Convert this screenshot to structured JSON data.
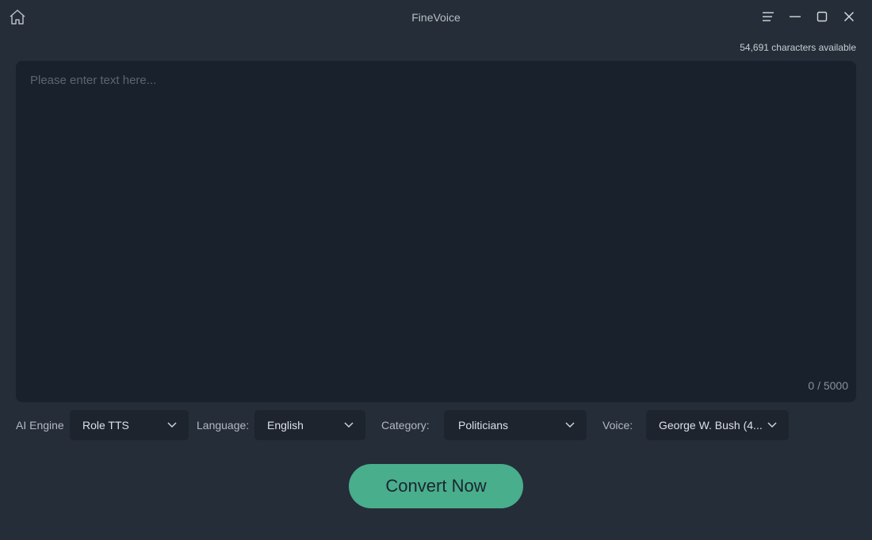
{
  "window": {
    "title": "FineVoice",
    "icons": {
      "home": "home-icon",
      "menu": "hamburger-menu-icon",
      "minimize": "minimize-icon",
      "maximize": "maximize-icon",
      "close": "close-icon"
    }
  },
  "header": {
    "characters_available": "54,691 characters available"
  },
  "editor": {
    "placeholder": "Please enter text here...",
    "value": "",
    "counter": "0 / 5000"
  },
  "options": {
    "ai_engine": {
      "label": "AI Engine",
      "value": "Role TTS"
    },
    "language": {
      "label": "Language:",
      "value": "English"
    },
    "category": {
      "label": "Category:",
      "value": "Politicians"
    },
    "voice": {
      "label": "Voice:",
      "value": "George W. Bush (4..."
    }
  },
  "actions": {
    "convert_label": "Convert Now",
    "convert_color": "#48ae8c"
  },
  "colors": {
    "background": "#252d38",
    "editor_background": "#19212c",
    "select_background": "#1d242e"
  }
}
